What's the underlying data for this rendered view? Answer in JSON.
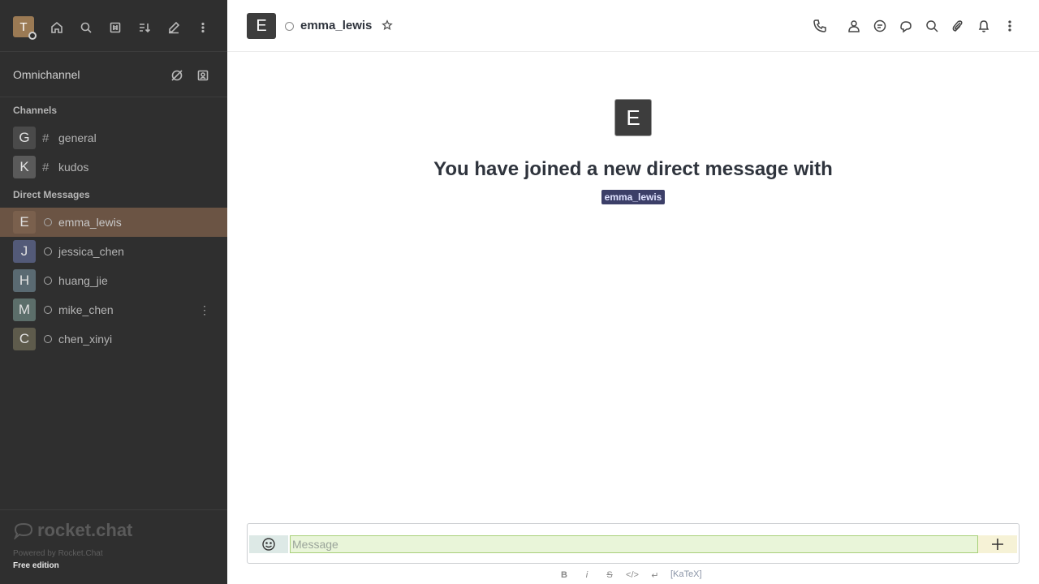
{
  "sidebar": {
    "user_initial": "T",
    "omnichannel_label": "Omnichannel",
    "channels_title": "Channels",
    "channels": [
      {
        "initial": "G",
        "name": "general",
        "color": "#4a4a4a"
      },
      {
        "initial": "K",
        "name": "kudos",
        "color": "#5a5a5a"
      }
    ],
    "dm_title": "Direct Messages",
    "direct_messages": [
      {
        "initial": "E",
        "name": "emma_lewis",
        "color": "#6b5444"
      },
      {
        "initial": "J",
        "name": "jessica_chen",
        "color": "#535a78"
      },
      {
        "initial": "H",
        "name": "huang_jie",
        "color": "#5a6a72"
      },
      {
        "initial": "M",
        "name": "mike_chen",
        "color": "#5c6e6a"
      },
      {
        "initial": "C",
        "name": "chen_xinyi",
        "color": "#5e5b4c"
      }
    ],
    "footer": {
      "logo_text": "rocket.chat",
      "powered_by": "Powered by Rocket.Chat",
      "edition": "Free edition"
    }
  },
  "header": {
    "avatar_initial": "E",
    "room_name": "emma_lewis"
  },
  "welcome": {
    "avatar_initial": "E",
    "text": "You have joined a new direct message with",
    "username": "emma_lewis"
  },
  "composer": {
    "placeholder": "Message",
    "katex_label": "[KaTeX]",
    "format_buttons": [
      "B",
      "i",
      "S",
      "</>",
      "↵"
    ]
  }
}
